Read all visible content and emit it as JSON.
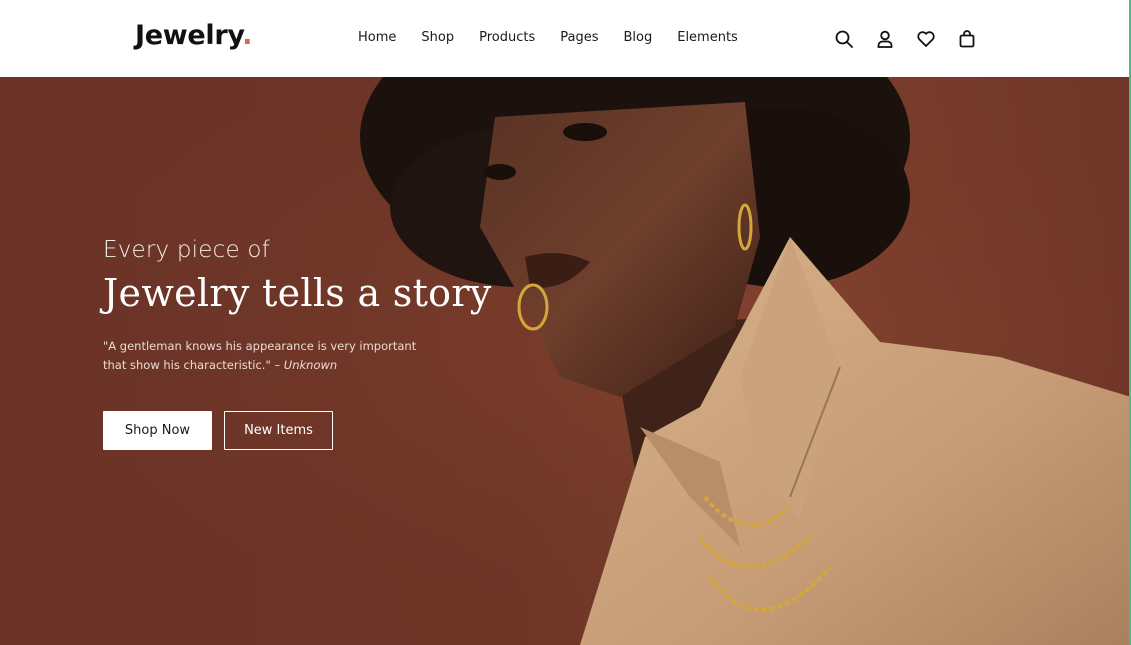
{
  "header": {
    "logo_text": "Jewelry",
    "logo_dot": ".",
    "nav": [
      {
        "label": "Home"
      },
      {
        "label": "Shop"
      },
      {
        "label": "Products"
      },
      {
        "label": "Pages"
      },
      {
        "label": "Blog"
      },
      {
        "label": "Elements"
      }
    ],
    "icons": [
      "search-icon",
      "user-icon",
      "heart-icon",
      "bag-icon"
    ]
  },
  "hero": {
    "eyebrow": "Every piece of",
    "headline": "Jewelry tells a story",
    "quote_text": "\"A gentleman knows his appearance is very important that show his characteristic.\"",
    "quote_author": "– Unknown",
    "primary_button": "Shop Now",
    "secondary_button": "New Items"
  },
  "colors": {
    "accent": "#c8714a",
    "hero_background": "#6e3527",
    "jacket": "#c9a07a",
    "gold": "#d4a73a"
  }
}
